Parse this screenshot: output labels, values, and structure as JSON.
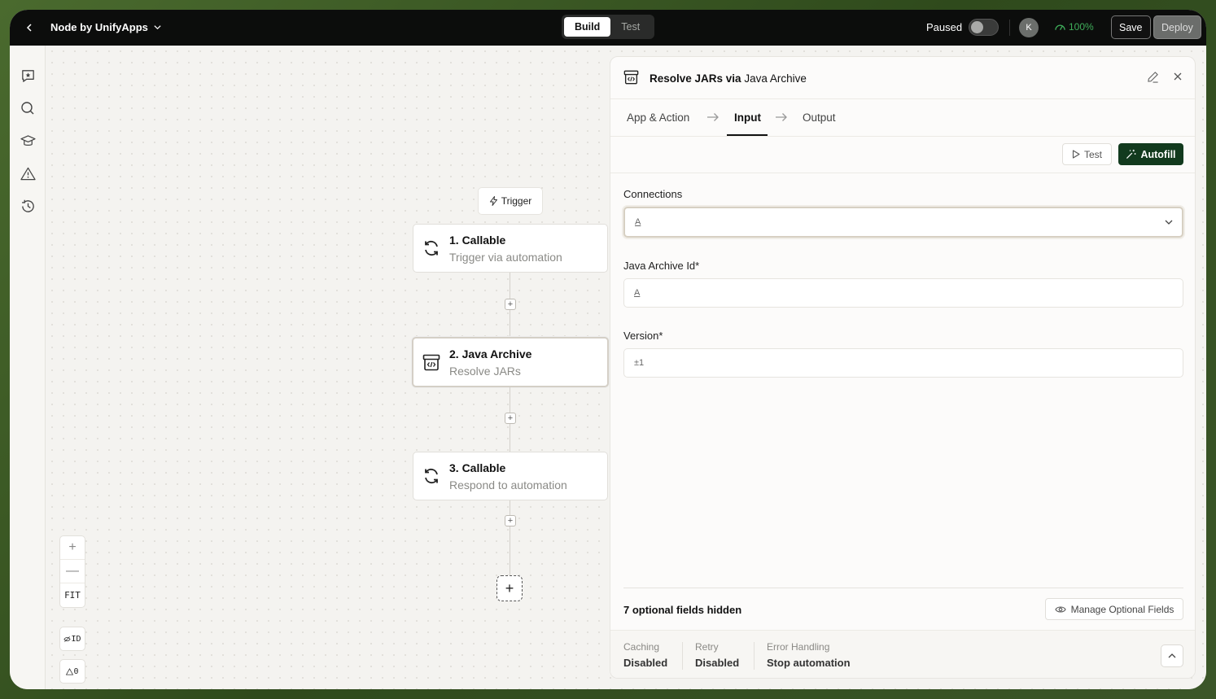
{
  "topbar": {
    "title": "Node by UnifyApps",
    "tabs": [
      {
        "label": "Build",
        "active": true
      },
      {
        "label": "Test",
        "active": false
      }
    ],
    "status_label": "Paused",
    "avatar_initial": "K",
    "health": "100%",
    "save_label": "Save",
    "deploy_label": "Deploy"
  },
  "rail": {
    "icons": [
      "chat-star-icon",
      "search-icon",
      "graduation-cap-icon",
      "warning-icon",
      "history-icon"
    ]
  },
  "canvas": {
    "trigger_label": "Trigger",
    "nodes": [
      {
        "title": "1. Callable",
        "subtitle": "Trigger via automation",
        "icon": "refresh-icon"
      },
      {
        "title": "2. Java Archive",
        "subtitle": "Resolve JARs",
        "icon": "archive-code-icon",
        "selected": true
      },
      {
        "title": "3. Callable",
        "subtitle": "Respond to automation",
        "icon": "refresh-icon"
      }
    ],
    "add_step": "+",
    "zoom": {
      "in": "+",
      "out": "—",
      "fit": "FIT"
    },
    "id_toggle": "ID",
    "warnings": "0"
  },
  "panel": {
    "title_action": "Resolve JARs via ",
    "title_app": "Java Archive",
    "tabs": [
      "App & Action",
      "Input",
      "Output"
    ],
    "active_tab": "Input",
    "test_label": "Test",
    "autofill_label": "Autofill",
    "fields": [
      {
        "label": "Connections",
        "prefix": "A",
        "value": ""
      },
      {
        "label": "Java Archive Id*",
        "prefix": "A",
        "value": ""
      },
      {
        "label": "Version*",
        "prefix": "±1",
        "value": ""
      }
    ],
    "hidden_fields": "7 optional fields hidden",
    "manage_label": "Manage Optional Fields",
    "footer": [
      {
        "label": "Caching",
        "value": "Disabled"
      },
      {
        "label": "Retry",
        "value": "Disabled"
      },
      {
        "label": "Error Handling",
        "value": "Stop automation"
      }
    ]
  },
  "colors": {
    "accent": "#123a1e",
    "health": "#3fae5a",
    "topbar": "#0c0d0c"
  }
}
